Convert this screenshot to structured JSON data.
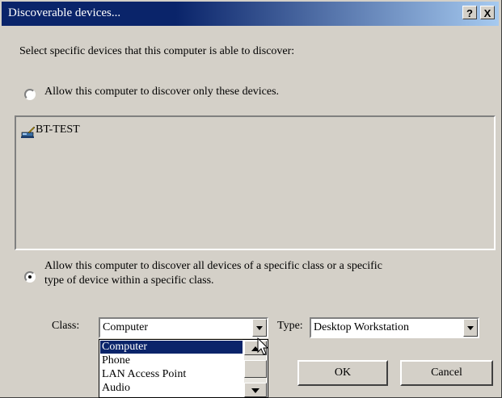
{
  "window": {
    "title": "Discoverable devices...",
    "help_label": "?",
    "close_label": "X"
  },
  "instructions": "Select specific devices that this computer is able to discover:",
  "option_specific": {
    "label": "Allow this computer to discover only these devices.",
    "selected": false
  },
  "device_list": [
    {
      "name": "BT-TEST",
      "icon": "computer-icon"
    }
  ],
  "option_class": {
    "label_line1": "Allow this computer to discover all devices of a specific class or a specific",
    "label_line2": "type of device within a specific class.",
    "selected": true
  },
  "class_field": {
    "label": "Class:",
    "value": "Computer",
    "options": [
      "Computer",
      "Phone",
      "LAN Access Point",
      "Audio"
    ]
  },
  "type_field": {
    "label": "Type:",
    "value": "Desktop Workstation"
  },
  "buttons": {
    "ok": "OK",
    "cancel": "Cancel"
  }
}
